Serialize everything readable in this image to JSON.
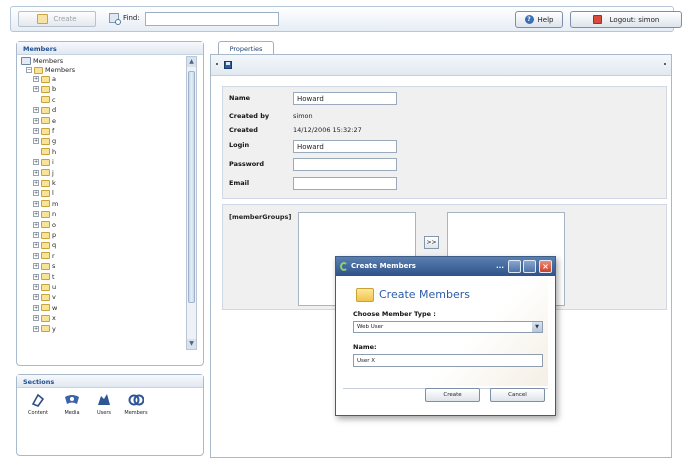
{
  "toolbar": {
    "create_label": "Create",
    "find_label": "Find:",
    "find_value": "",
    "help_label": "Help",
    "logout_label": "Logout: simon"
  },
  "members_panel": {
    "title": "Members",
    "root_label": "Members",
    "members_label": "Members",
    "letters": [
      "a",
      "b",
      "c",
      "d",
      "e",
      "f",
      "g",
      "h",
      "i",
      "j",
      "k",
      "l",
      "m",
      "n",
      "o",
      "p",
      "q",
      "r",
      "s",
      "t",
      "u",
      "v",
      "w",
      "x",
      "y"
    ]
  },
  "sections_panel": {
    "title": "Sections",
    "items": [
      {
        "label": "Content",
        "icon": "content-icon"
      },
      {
        "label": "Media",
        "icon": "media-icon"
      },
      {
        "label": "Users",
        "icon": "users-icon"
      },
      {
        "label": "Members",
        "icon": "members-icon"
      }
    ]
  },
  "properties": {
    "tab_label": "Properties",
    "name_label": "Name",
    "name_value": "Howard",
    "created_by_label": "Created by",
    "created_by_value": "simon",
    "created_label": "Created",
    "created_value": "14/12/2006 15:32:27",
    "login_label": "Login",
    "login_value": "Howard",
    "password_label": "Password",
    "password_value": "",
    "email_label": "Email",
    "email_value": "",
    "groups_label": "[memberGroups]",
    "move_button_label": ">>"
  },
  "modal": {
    "title": "Create Members",
    "heading": "Create Members",
    "type_label": "Choose Member Type :",
    "type_value": "Web User",
    "name_label": "Name:",
    "name_value": "User X",
    "create_label": "Create",
    "cancel_label": "Cancel",
    "title_dots": "..."
  },
  "colors": {
    "accent": "#2b5da8",
    "titlebar": "#2e5289",
    "panel_border": "#a8b9cc",
    "close_button": "#c9412b"
  }
}
